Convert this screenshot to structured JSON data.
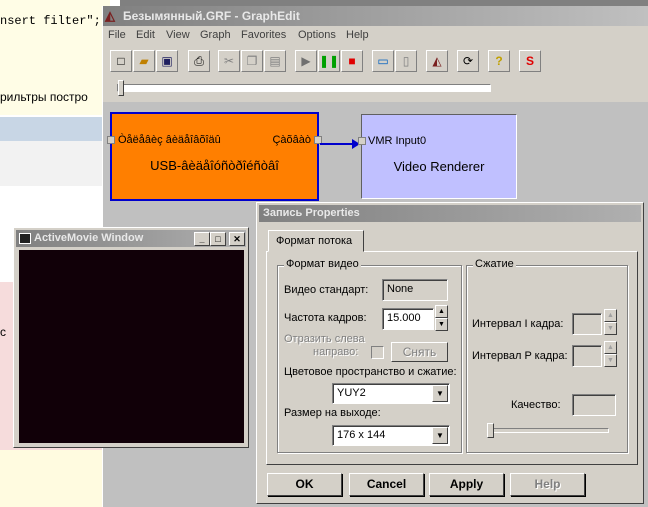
{
  "background_page": {
    "code_line": "nsert filter\";",
    "text_line": "рильтры постро",
    "pink_text": "с"
  },
  "graphedit": {
    "title": "Безымянный.GRF - GraphEdit",
    "menu": [
      "File",
      "Edit",
      "View",
      "Graph",
      "Favorites",
      "Options",
      "Help"
    ],
    "filters": [
      {
        "name": "USB-âèäåîóñòðîéñòâî",
        "pin_in": "Òåëåâèç âèäåîâõîäû",
        "pin_out": "Çàõâàò",
        "color": "#ff7f00"
      },
      {
        "name": "Video Renderer",
        "pin_in": "VMR Input0",
        "color": "#c0c0ff"
      }
    ]
  },
  "activemovie": {
    "title": "ActiveMovie Window"
  },
  "properties": {
    "title": "Запись Properties",
    "tab": "Формат потока",
    "video_group": {
      "label": "Формат видео",
      "standard_label": "Видео стандарт:",
      "standard_value": "None",
      "framerate_label": "Частота кадров:",
      "framerate_value": "15.000",
      "mirror_label_1": "Отразить слева",
      "mirror_label_2": "направо:",
      "snap_button": "Снять",
      "colorspace_label": "Цветовое пространство и сжатие:",
      "colorspace_value": "YUY2",
      "output_size_label": "Размер на выходе:",
      "output_size_value": "176 x 144"
    },
    "compression_group": {
      "label": "Сжатие",
      "i_frame_label": "Интервал I кадра:",
      "p_frame_label": "Интервал P кадра:",
      "quality_label": "Качество:"
    },
    "buttons": {
      "ok": "OK",
      "cancel": "Cancel",
      "apply": "Apply",
      "help": "Help"
    }
  }
}
